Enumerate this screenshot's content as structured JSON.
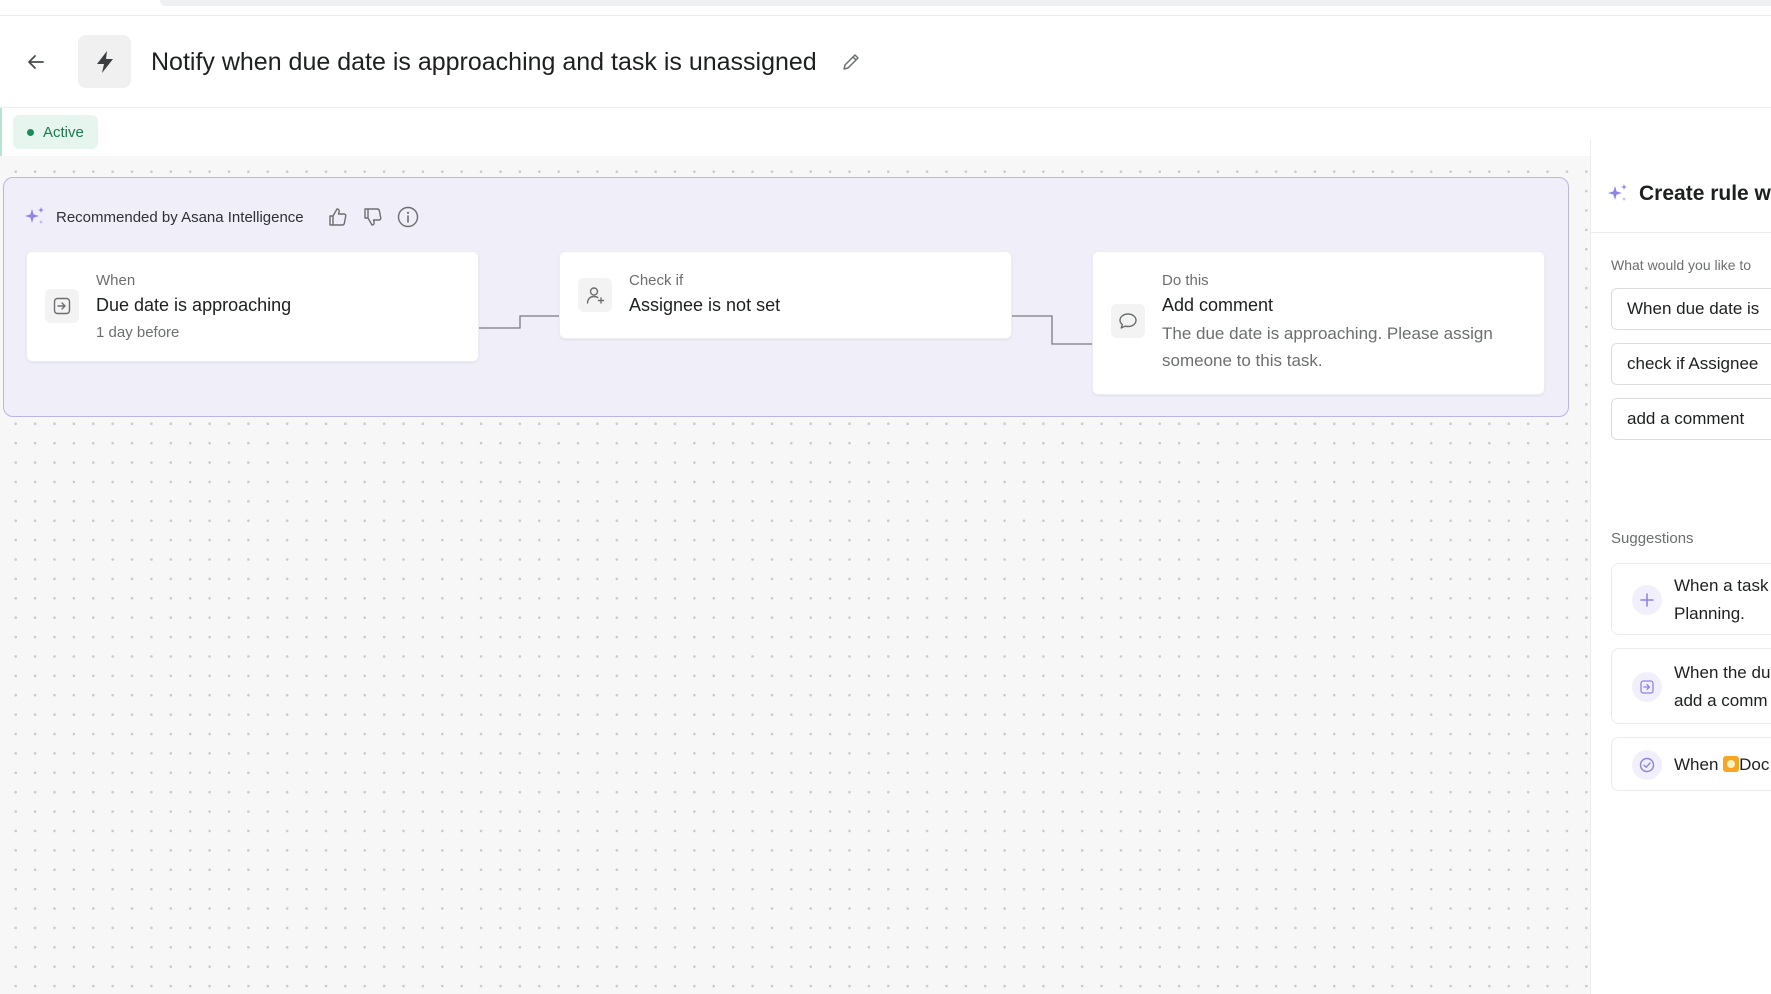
{
  "header": {
    "title": "Notify when due date is approaching and task is unassigned",
    "status": "Active"
  },
  "recommendation": {
    "label": "Recommended by Asana Intelligence",
    "when": {
      "label": "When",
      "title": "Due date is approaching",
      "sub": "1 day before"
    },
    "check": {
      "label": "Check if",
      "title": "Assignee is not set"
    },
    "action": {
      "label": "Do this",
      "title": "Add comment",
      "desc_line1": "The due date is approaching. Please assign",
      "desc_line2": "someone to this task."
    }
  },
  "panel": {
    "title": "Create rule wi",
    "question": "What would you like to",
    "fields": [
      "When due date is",
      "check if Assignee",
      "add a comment"
    ],
    "suggestions_label": "Suggestions",
    "suggestions": [
      {
        "line1": "When a task",
        "line2": "Planning.",
        "icon": "plus-icon"
      },
      {
        "line1": "When the du",
        "line2": "add a comm",
        "icon": "date-arrow-icon"
      },
      {
        "pre": "When ",
        "post": "Doc",
        "icon": "check-circle-icon"
      }
    ]
  },
  "colors": {
    "accent_purple": "#8c84e8",
    "group_bg": "#efeef9",
    "status_green": "#1e8a57",
    "status_bg": "#e6f6ef",
    "canvas_bg": "#f7f7f8"
  }
}
